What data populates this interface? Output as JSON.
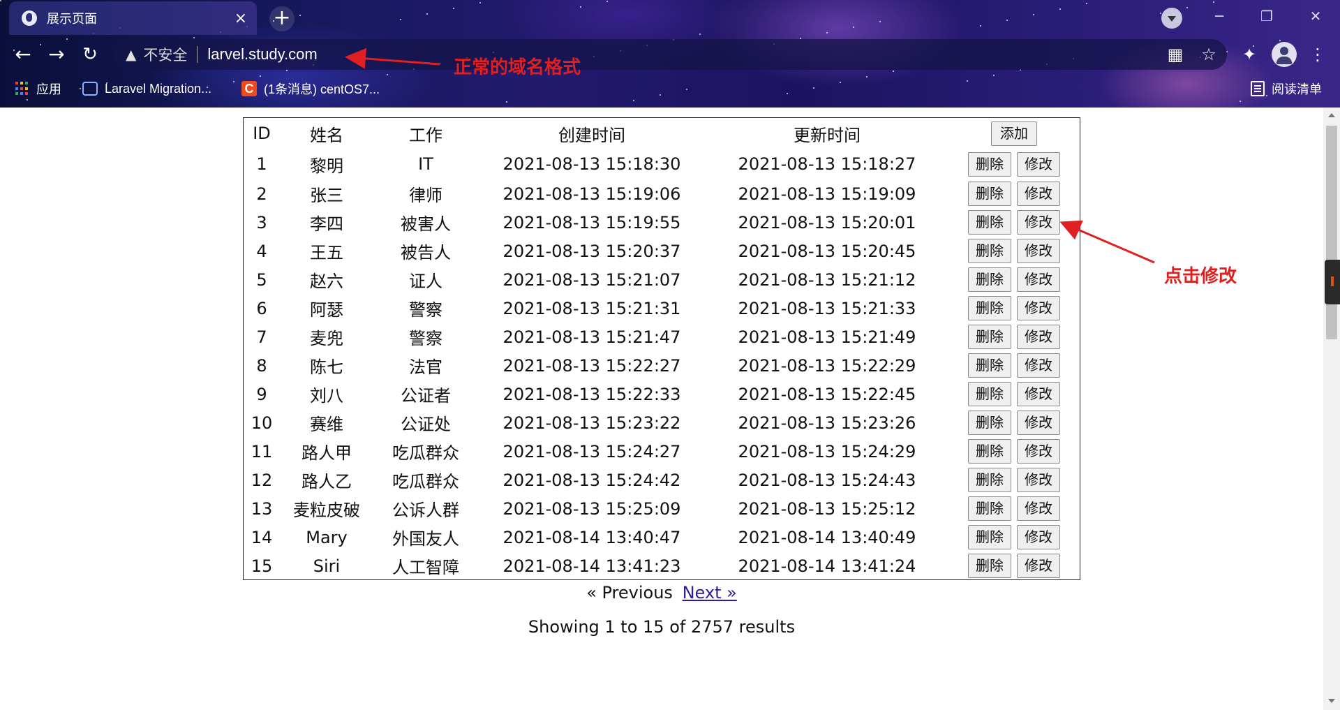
{
  "browser": {
    "tab_title": "展示页面",
    "tab_close": "×",
    "new_tab": "+",
    "security_label": "不安全",
    "url": "larvel.study.com",
    "bookmarks": [
      {
        "label": "应用"
      },
      {
        "label": "Laravel Migration..."
      },
      {
        "label": "(1条消息) centOS7..."
      }
    ],
    "reading_list": "阅读清单"
  },
  "table": {
    "headers": [
      "ID",
      "姓名",
      "工作",
      "创建时间",
      "更新时间"
    ],
    "add_label": "添加",
    "delete_label": "删除",
    "edit_label": "修改",
    "rows": [
      {
        "id": "1",
        "name": "黎明",
        "job": "IT",
        "created": "2021-08-13 15:18:30",
        "updated": "2021-08-13 15:18:27"
      },
      {
        "id": "2",
        "name": "张三",
        "job": "律师",
        "created": "2021-08-13 15:19:06",
        "updated": "2021-08-13 15:19:09"
      },
      {
        "id": "3",
        "name": "李四",
        "job": "被害人",
        "created": "2021-08-13 15:19:55",
        "updated": "2021-08-13 15:20:01"
      },
      {
        "id": "4",
        "name": "王五",
        "job": "被告人",
        "created": "2021-08-13 15:20:37",
        "updated": "2021-08-13 15:20:45"
      },
      {
        "id": "5",
        "name": "赵六",
        "job": "证人",
        "created": "2021-08-13 15:21:07",
        "updated": "2021-08-13 15:21:12"
      },
      {
        "id": "6",
        "name": "阿瑟",
        "job": "警察",
        "created": "2021-08-13 15:21:31",
        "updated": "2021-08-13 15:21:33"
      },
      {
        "id": "7",
        "name": "麦兜",
        "job": "警察",
        "created": "2021-08-13 15:21:47",
        "updated": "2021-08-13 15:21:49"
      },
      {
        "id": "8",
        "name": "陈七",
        "job": "法官",
        "created": "2021-08-13 15:22:27",
        "updated": "2021-08-13 15:22:29"
      },
      {
        "id": "9",
        "name": "刘八",
        "job": "公证者",
        "created": "2021-08-13 15:22:33",
        "updated": "2021-08-13 15:22:45"
      },
      {
        "id": "10",
        "name": "赛维",
        "job": "公证处",
        "created": "2021-08-13 15:23:22",
        "updated": "2021-08-13 15:23:26"
      },
      {
        "id": "11",
        "name": "路人甲",
        "job": "吃瓜群众",
        "created": "2021-08-13 15:24:27",
        "updated": "2021-08-13 15:24:29"
      },
      {
        "id": "12",
        "name": "路人乙",
        "job": "吃瓜群众",
        "created": "2021-08-13 15:24:42",
        "updated": "2021-08-13 15:24:43"
      },
      {
        "id": "13",
        "name": "麦粒皮破",
        "job": "公诉人群",
        "created": "2021-08-13 15:25:09",
        "updated": "2021-08-13 15:25:12"
      },
      {
        "id": "14",
        "name": "Mary",
        "job": "外国友人",
        "created": "2021-08-14 13:40:47",
        "updated": "2021-08-14 13:40:49"
      },
      {
        "id": "15",
        "name": "Siri",
        "job": "人工智障",
        "created": "2021-08-14 13:41:23",
        "updated": "2021-08-14 13:41:24"
      }
    ]
  },
  "pagination": {
    "previous": "« Previous",
    "next": "Next »",
    "summary": "Showing 1 to 15 of 2757 results"
  },
  "annotations": {
    "domain_note": "正常的域名格式",
    "click_edit_note": "点击修改",
    "color": "#e02020"
  }
}
